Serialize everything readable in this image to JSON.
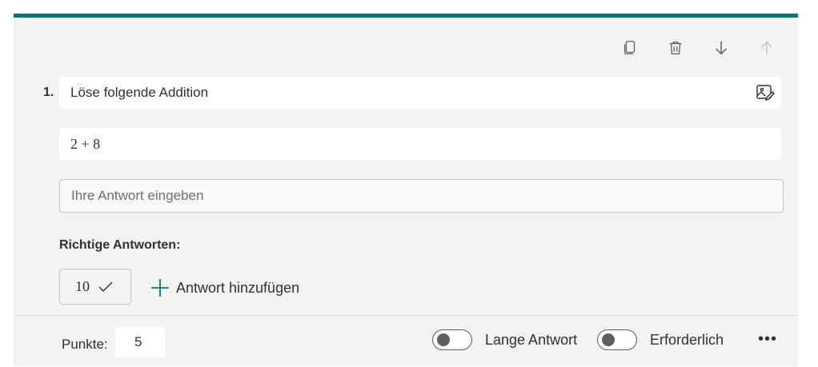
{
  "question": {
    "number": "1.",
    "title": "Löse folgende Addition",
    "math": "2 + 8",
    "answer_placeholder": "Ihre Antwort eingeben"
  },
  "correct": {
    "label": "Richtige Antworten:",
    "answers": [
      "10"
    ],
    "add_label": "Antwort hinzufügen"
  },
  "footer": {
    "points_label": "Punkte:",
    "points_value": "5",
    "long_answer_label": "Lange Antwort",
    "required_label": "Erforderlich",
    "more_label": "•••"
  },
  "toolbar": {
    "icons": [
      "copy-icon",
      "delete-icon",
      "move-down-icon",
      "move-up-icon"
    ]
  },
  "colors": {
    "accent": "#03787c",
    "card_bg": "#f3f3f3"
  }
}
